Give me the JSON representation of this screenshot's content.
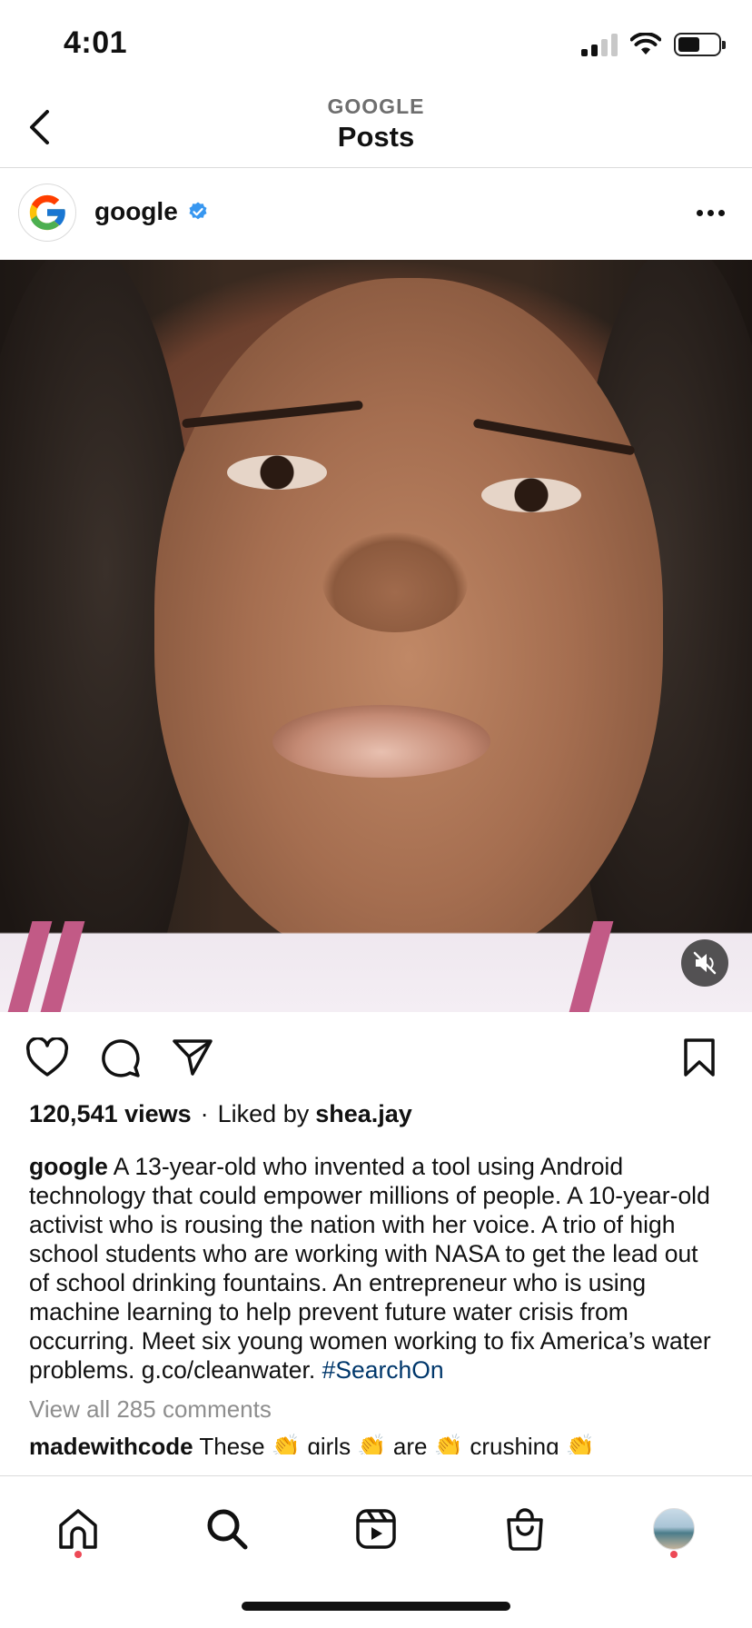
{
  "status_bar": {
    "time": "4:01"
  },
  "header": {
    "subtitle": "GOOGLE",
    "title": "Posts"
  },
  "post": {
    "username": "google",
    "verified": true,
    "views": "120,541 views",
    "separator": "·",
    "liked_by_prefix": "Liked by",
    "liked_by_user": "shea.jay",
    "caption_user": "google",
    "caption_text": "A 13-year-old who invented a tool using Android technology that could empower millions of people. A 10-year-old activist who is rousing the nation with her voice. A trio of high school students who are working with NASA to get the lead out of school drinking fountains. An entrepreneur who is using machine learning to help prevent future water crisis from occurring. Meet six young women working to fix America’s water problems. g.co/cleanwater.",
    "hashtag": "#SearchOn",
    "view_comments": "View all 285 comments",
    "comment_peek_user": "madewithcode",
    "comment_peek_text": "These 👏 girls 👏 are 👏 crushing 👏"
  },
  "colors": {
    "accent_link": "#00376b",
    "notification_dot": "#ed4956",
    "verified_badge": "#3897f0"
  },
  "icons": {
    "back": "chevron-left-icon",
    "more": "more-horizontal-icon",
    "mute": "speaker-muted-icon",
    "like": "heart-icon",
    "comment": "comment-bubble-icon",
    "share": "paper-plane-icon",
    "save": "bookmark-icon",
    "tabs": [
      "home-icon",
      "search-icon",
      "reels-icon",
      "shop-bag-icon",
      "profile-avatar"
    ]
  }
}
